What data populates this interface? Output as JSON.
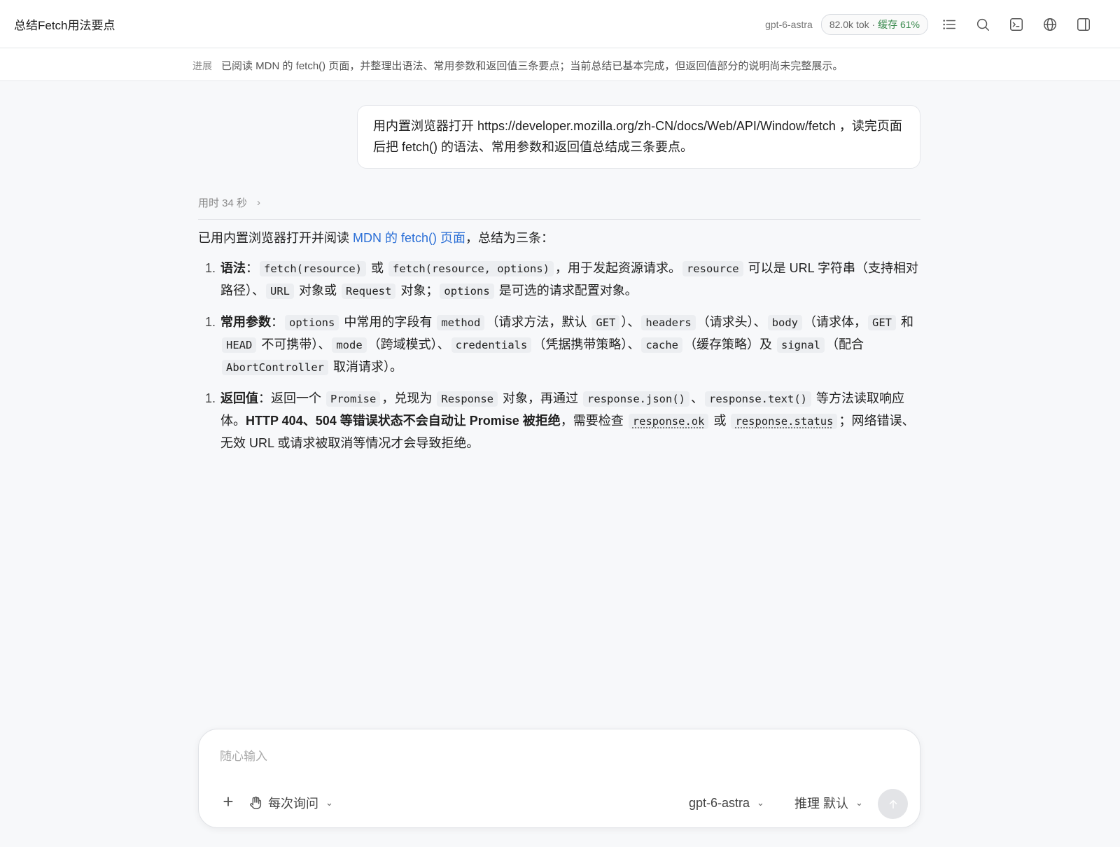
{
  "header": {
    "title": "总结Fetch用法要点",
    "model": "gpt-6-astra",
    "tokens": "82.0k tok · ",
    "cache": "缓存 61%"
  },
  "progress": {
    "label": "进展",
    "text": "已阅读 MDN 的 fetch() 页面，并整理出语法、常用参数和返回值三条要点；当前总结已基本完成，但返回值部分的说明尚未完整展示。"
  },
  "user_message": "用内置浏览器打开 https://developer.mozilla.org/zh-CN/docs/Web/API/Window/fetch ，读完页面后把 fetch() 的语法、常用参数和返回值总结成三条要点。",
  "assistant": {
    "elapsed": "用时 34 秒",
    "intro_prefix": "已用内置浏览器打开并阅读 ",
    "intro_link": "MDN 的 fetch() 页面",
    "intro_suffix": "，总结为三条：",
    "items": [
      {
        "num": "1.",
        "title": "语法",
        "sep": "：",
        "c1": "fetch(resource)",
        "t1": " 或 ",
        "c2": "fetch(resource, options)",
        "t2": "，用于发起资源请求。",
        "c3": "resource",
        "t3": " 可以是 URL 字符串（支持相对路径）、",
        "c4": "URL",
        "t4": " 对象或 ",
        "c5": "Request",
        "t5": " 对象；",
        "c6": "options",
        "t6": " 是可选的请求配置对象。"
      },
      {
        "num": "1.",
        "title": "常用参数",
        "sep": "：",
        "c1": "options",
        "t1": " 中常用的字段有 ",
        "c2": "method",
        "t2": "（请求方法，默认 ",
        "c3": "GET",
        "t3": "）、",
        "c4": "headers",
        "t4": "（请求头）、",
        "c5": "body",
        "t5": "（请求体，",
        "c6": "GET",
        "t6": " 和 ",
        "c7": "HEAD",
        "t7": " 不可携带）、",
        "c8": "mode",
        "t8": "（跨域模式）、",
        "c9": "credentials",
        "t9": "（凭据携带策略）、",
        "c10": "cache",
        "t10": "（缓存策略）及 ",
        "c11": "signal",
        "t11": "（配合 ",
        "c12": "AbortController",
        "t12": " 取消请求）。"
      },
      {
        "num": "1.",
        "title": "返回值",
        "sep": "：",
        "t0": "返回一个 ",
        "c1": "Promise",
        "t1": "，兑现为 ",
        "c2": "Response",
        "t2": " 对象，再通过 ",
        "c3": "response.json()",
        "t3": "、",
        "c4": "response.text()",
        "t4": " 等方法读取响应体。",
        "b1": "HTTP 404、504 等错误状态不会自动让 Promise 被拒绝",
        "t5": "，需要检查 ",
        "c5": "response.ok",
        "t6": " 或 ",
        "c6": "response.status",
        "t7": "；网络错误、无效 URL 或请求被取消等情况才会导致拒绝。"
      }
    ]
  },
  "composer": {
    "placeholder": "随心输入",
    "ask_mode": "每次询问",
    "model": "gpt-6-astra",
    "reasoning": "推理 默认"
  }
}
